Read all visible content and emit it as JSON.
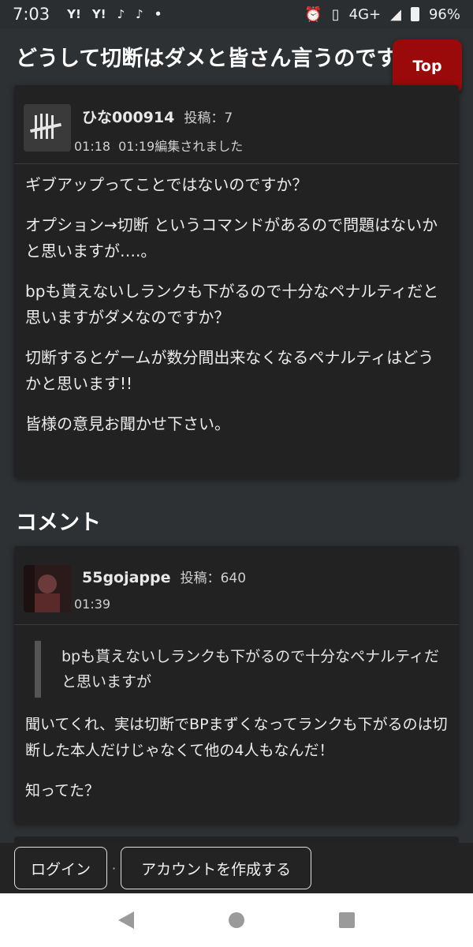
{
  "status_bar": {
    "time": "7:03",
    "icons_left": [
      "Y!",
      "Y!",
      "♪",
      "♪",
      "•"
    ],
    "network": "4G+",
    "battery": "96%"
  },
  "page": {
    "title": "どうして切断はダメと皆さん言うのですか",
    "top_button": "Top"
  },
  "post": {
    "author": "ひな000914",
    "post_label": "投稿：",
    "post_count": "7",
    "time": "01:18",
    "edited": "01:19編集されました",
    "paragraphs": [
      "ギブアップってことではないのですか？",
      "オプション→切断 というコマンドがあるので問題はないかと思いますが….。",
      "bpも貰えないしランクも下がるので十分なペナルティだと思いますがダメなのですか？",
      "切断するとゲームが数分間出来なくなるペナルティはどうかと思います!!",
      "皆様の意見お聞かせ下さい。"
    ]
  },
  "comments_section": {
    "title": "コメント"
  },
  "comment": {
    "author": "55gojappe",
    "post_label": "投稿：",
    "post_count": "640",
    "time": "01:39",
    "quote": "bpも貰えないしランクも下がるので十分なペナルティだと思いますが",
    "paragraphs": [
      "聞いてくれ、実は切断でBPまずくなってランクも下がるのは切断した本人だけじゃなくて他の4人もなんだ！",
      "知ってた？"
    ]
  },
  "auth": {
    "login": "ログイン",
    "separator": "·",
    "register": "アカウントを作成する"
  },
  "colors": {
    "background": "#2e3134",
    "card": "#222222",
    "top_button": "#9a0a0a"
  }
}
